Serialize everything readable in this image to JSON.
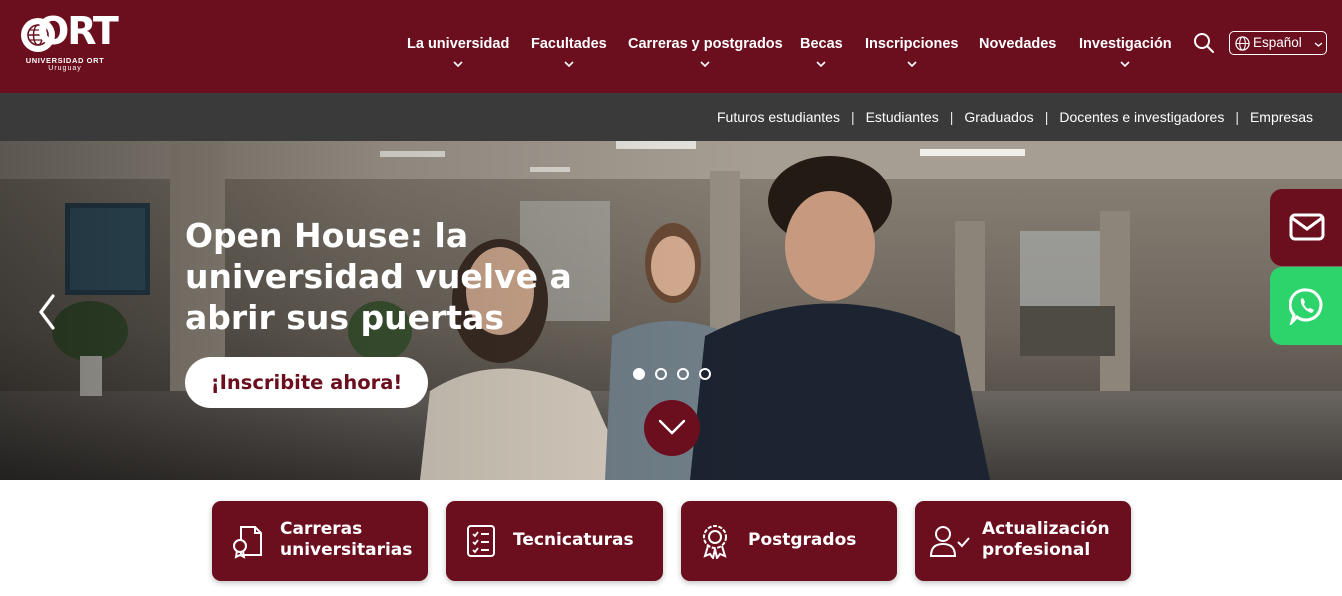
{
  "brand": {
    "logo_word": "ORT",
    "logo_line1": "UNIVERSIDAD ORT",
    "logo_line2": "Uruguay"
  },
  "colors": {
    "primary": "#6b0f1f",
    "subbar": "#3a3a3a",
    "whatsapp": "#2cd46b"
  },
  "nav": {
    "items": [
      {
        "label": "La universidad",
        "has_dropdown": true
      },
      {
        "label": "Facultades",
        "has_dropdown": true
      },
      {
        "label": "Carreras y postgrados",
        "has_dropdown": true
      },
      {
        "label": "Becas",
        "has_dropdown": true
      },
      {
        "label": "Inscripciones",
        "has_dropdown": true
      },
      {
        "label": "Novedades",
        "has_dropdown": false
      },
      {
        "label": "Investigación",
        "has_dropdown": true
      }
    ],
    "search_icon": "search-icon",
    "language": "Español"
  },
  "subnav": {
    "items": [
      "Futuros estudiantes",
      "Estudiantes",
      "Graduados",
      "Docentes e investigadores",
      "Empresas"
    ]
  },
  "hero": {
    "title": "Open House: la universidad vuelve a abrir sus puertas",
    "cta": "¡Inscribite ahora!",
    "slides_total": 4,
    "active_slide": 1
  },
  "side_buttons": {
    "mail_icon": "mail-icon",
    "whatsapp_icon": "whatsapp-icon"
  },
  "cards": [
    {
      "label_line1": "Carreras",
      "label_line2": "universitarias",
      "icon": "diploma-icon"
    },
    {
      "label_line1": "Tecnicaturas",
      "label_line2": "",
      "icon": "checklist-icon"
    },
    {
      "label_line1": "Postgrados",
      "label_line2": "",
      "icon": "medal-icon"
    },
    {
      "label_line1": "Actualización",
      "label_line2": "profesional",
      "icon": "user-check-icon"
    }
  ]
}
